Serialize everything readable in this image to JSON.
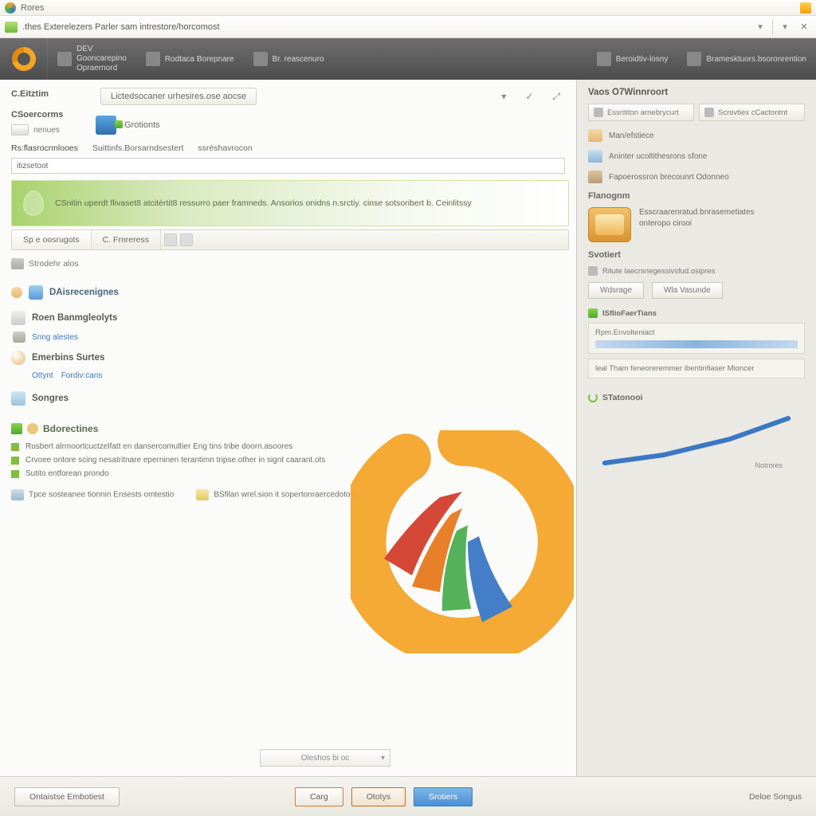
{
  "titlebar": {
    "text": "Rores"
  },
  "addressbar": {
    "path": ".thes Exterelezers Parler sam intrestore/horcomost"
  },
  "cmdbar": {
    "new_top": "DEV",
    "new_mid": "Gooncarepino",
    "new_bot": "Opraernord",
    "item2": "Rodtaca Borepnare",
    "item3": "Br. reascenuro",
    "right1": "Beroidtiv-losny",
    "right2": "Bramesktuors.bsoronrention"
  },
  "left": {
    "heading": "C.Eitztim",
    "pill": "Lictedsocaner urhesires.ose aocse",
    "side_title": "CSoercorms",
    "side_item": "nenues",
    "shield_label": "Grotionts",
    "tabs": {
      "a": "Rs:flasrocrmlooes",
      "b": "Suittinfs.Borsarndsestert",
      "c": "ssréshavrocon"
    },
    "field_label": "itizsetoot",
    "banner": "CSnitin uperdt flivaset8 atcitértit8 ressurro paer framneds. Ansorios onidns n.srctiy. cinse sotsoribert b. Ceinlitssy",
    "sub1": "Sp e oosrugots",
    "sub2": "C. Frnreress",
    "crumb": "Strodehr alos",
    "cat_top_title": "DAisrecenignes",
    "cat1_title": "Roen Banmgleolyts",
    "cat1_link": "Snng alestes",
    "cat2_title": "Emerbins Surtes",
    "cat2_link1": "Ottynt",
    "cat2_link2": "Fordiv:cans",
    "cat3_title": "Songres",
    "det_title": "Bdorectines",
    "d1": "Rusbert alrmoortcuctzelfatt en dansercomultier Eng tins tribe doorn.asoores",
    "d2": "Crvoee ontore scing nesatritnare eperninen terantimn tripse.other in signt caarant.ots",
    "d3": "Sutito entforean prondo",
    "df1": "Tpce sosteanee tionnin Ensests omtestio",
    "df2": "BSfilan wrel.sion it sopertonraercedotoa",
    "dropdown": "Oleshos bi oc"
  },
  "right": {
    "title": "Vaos O7Winnroort",
    "tab1": "Essrititon arnebrycurt",
    "tab2": "Scrovtiex cCactontnt",
    "li1": "Man/efstiece",
    "li2": "Aninter ucoltithesrons sfone",
    "li3": "Fapoerossron brecounrt Odonneo",
    "sub1": "Flanognm",
    "feat_t": "Esscraarenratud.bnrasemetiates",
    "feat_b": "onteropo cirooi",
    "sect": "Svotiert",
    "sect_row": "Ritute laecrsnegessivsfud.osipres",
    "btn1": "Wdsrage",
    "btn2": "Wla Vasunde",
    "panel_title": "ISflioFaerTians",
    "link1": "Rpm.Envolteniact",
    "link2": "leal Tham feneoreremmer  ibentinfiaser Mioncer",
    "stat_title": "STatonooi",
    "chart_label": "Notrores"
  },
  "footer": {
    "b1": "Ontaistse Embotiest",
    "b2": "Carg",
    "b3": "Ototys",
    "b4": "Srotiers",
    "link": "Deloe Songus"
  },
  "chart_data": {
    "type": "line",
    "x": [
      0,
      1,
      2,
      3
    ],
    "values": [
      5,
      12,
      28,
      46
    ],
    "ylim": [
      0,
      50
    ],
    "title": "STatonooi"
  }
}
